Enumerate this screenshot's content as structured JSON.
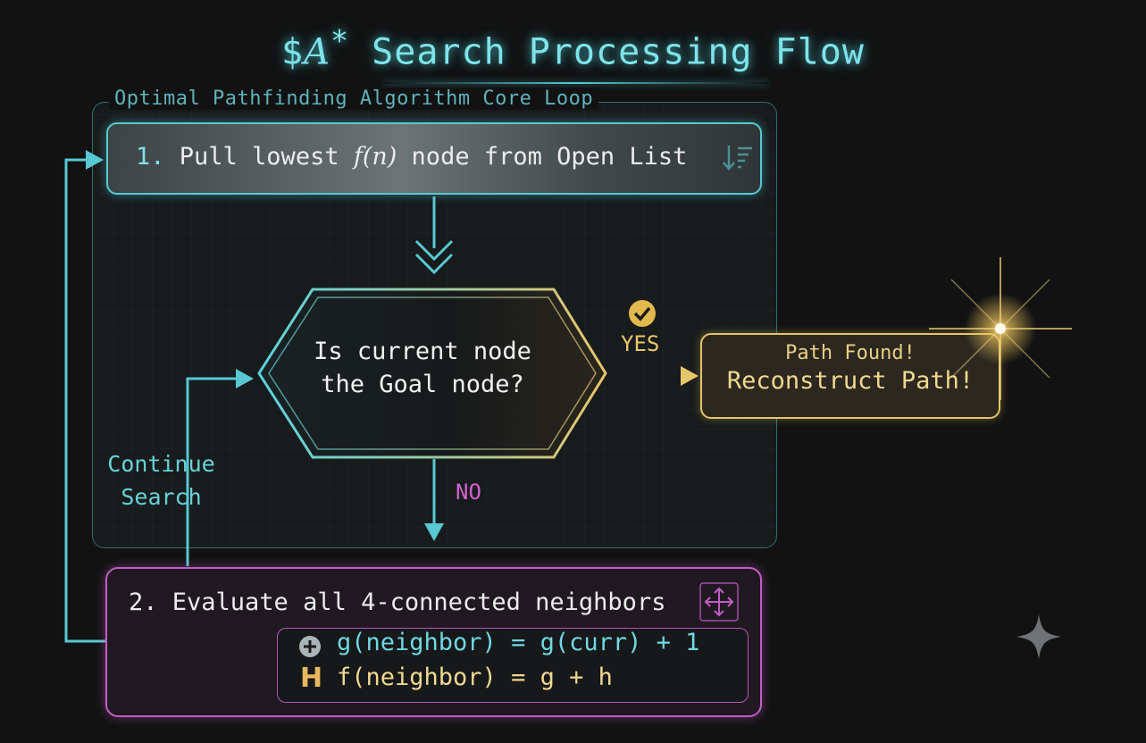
{
  "title": {
    "prefix": "$",
    "math": "A",
    "star": "*",
    "rest": " Search Processing Flow"
  },
  "panel": {
    "label": "Optimal Pathfinding Algorithm Core Loop"
  },
  "step1": {
    "number": "1.",
    "text_before": " Pull lowest ",
    "math": "f(n)",
    "text_after": " node from Open List"
  },
  "decision": {
    "line1": "Is current node",
    "line2": "the Goal node?"
  },
  "branches": {
    "yes": "YES",
    "no": "NO",
    "continue_line1": "Continue",
    "continue_line2": "Search"
  },
  "result": {
    "line1": "Path Found!",
    "line2": "Reconstruct Path!"
  },
  "step2": {
    "text": "2. Evaluate all 4-connected neighbors",
    "formula_g": "g(neighbor) = g(curr) + 1",
    "formula_f": "f(neighbor) = g + h",
    "h_icon_text": "H"
  },
  "icons": {
    "sort": "sort-descending-icon",
    "check": "check-circle-icon",
    "move": "move-arrows-icon",
    "plus": "plus-circle-icon",
    "gem": "four-point-star-icon",
    "sparkle": "sparkle-icon"
  },
  "colors": {
    "cyan": "#58c8d2",
    "gold": "#e3c469",
    "magenta": "#c25cc6",
    "background": "#121212"
  }
}
